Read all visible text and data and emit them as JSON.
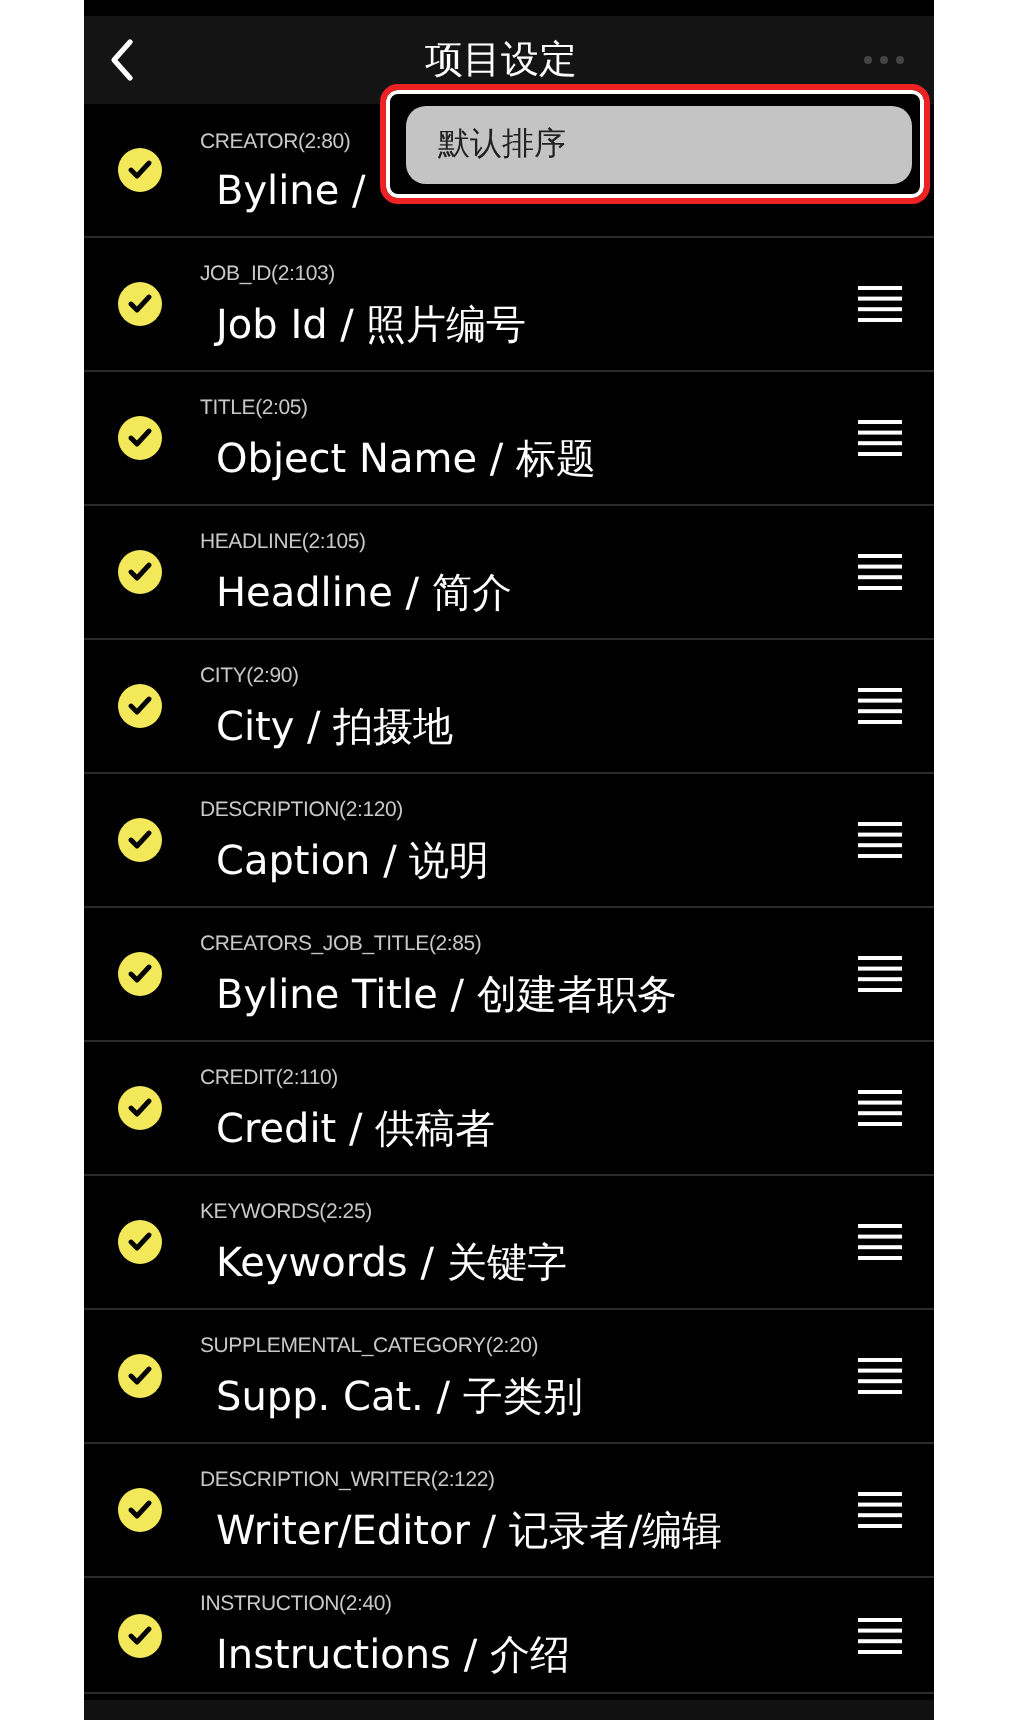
{
  "header": {
    "title": "项目设定"
  },
  "menu": {
    "items": [
      {
        "label": "默认排序",
        "selected": false
      }
    ]
  },
  "fields": [
    {
      "code": "CREATOR(2:80)",
      "title": "Byline /",
      "checked": true,
      "handle": false
    },
    {
      "code": "JOB_ID(2:103)",
      "title": "Job Id / 照片编号",
      "checked": true,
      "handle": true
    },
    {
      "code": "TITLE(2:05)",
      "title": "Object Name / 标题",
      "checked": true,
      "handle": true
    },
    {
      "code": "HEADLINE(2:105)",
      "title": "Headline / 简介",
      "checked": true,
      "handle": true
    },
    {
      "code": "CITY(2:90)",
      "title": "City / 拍摄地",
      "checked": true,
      "handle": true
    },
    {
      "code": "DESCRIPTION(2:120)",
      "title": "Caption / 说明",
      "checked": true,
      "handle": true
    },
    {
      "code": "CREATORS_JOB_TITLE(2:85)",
      "title": "Byline Title / 创建者职务",
      "checked": true,
      "handle": true
    },
    {
      "code": "CREDIT(2:110)",
      "title": "Credit / 供稿者",
      "checked": true,
      "handle": true
    },
    {
      "code": "KEYWORDS(2:25)",
      "title": "Keywords / 关键字",
      "checked": true,
      "handle": true
    },
    {
      "code": "SUPPLEMENTAL_CATEGORY(2:20)",
      "title": "Supp. Cat. / 子类别",
      "checked": true,
      "handle": true
    },
    {
      "code": "DESCRIPTION_WRITER(2:122)",
      "title": "Writer/Editor / 记录者/编辑",
      "checked": true,
      "handle": true
    },
    {
      "code": "INSTRUCTION(2:40)",
      "title": "Instructions / 介绍",
      "checked": true,
      "handle": true
    }
  ]
}
